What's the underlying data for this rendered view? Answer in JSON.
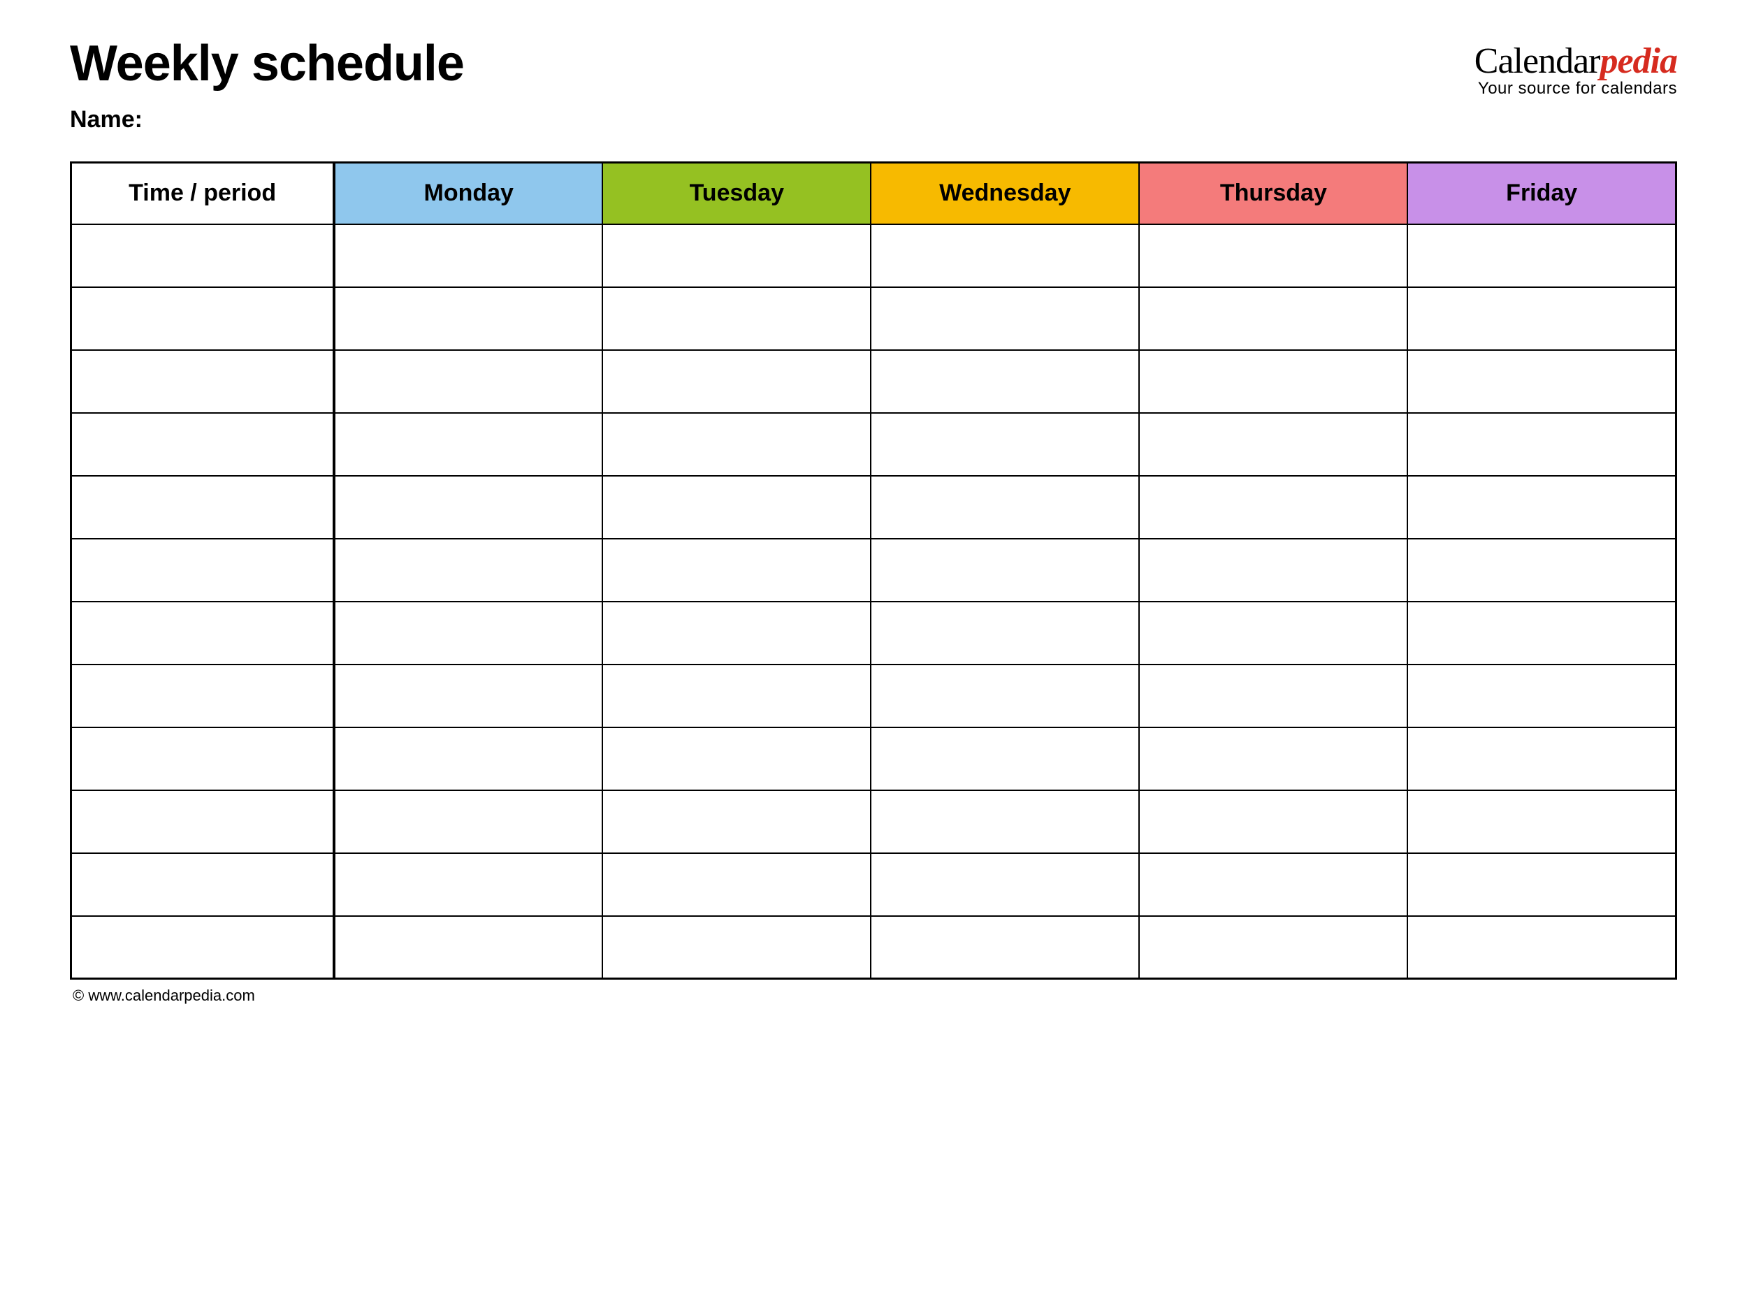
{
  "header": {
    "title": "Weekly schedule",
    "name_label": "Name:"
  },
  "brand": {
    "part1": "Calendar",
    "part2": "pedia",
    "tagline": "Your source for calendars"
  },
  "table": {
    "columns": [
      {
        "label": "Time / period",
        "color": "#ffffff"
      },
      {
        "label": "Monday",
        "color": "#8fc7ed"
      },
      {
        "label": "Tuesday",
        "color": "#95c122"
      },
      {
        "label": "Wednesday",
        "color": "#f7ba00"
      },
      {
        "label": "Thursday",
        "color": "#f47b7b"
      },
      {
        "label": "Friday",
        "color": "#c890e8"
      }
    ],
    "row_count": 12
  },
  "footer": {
    "copyright": "© www.calendarpedia.com"
  }
}
